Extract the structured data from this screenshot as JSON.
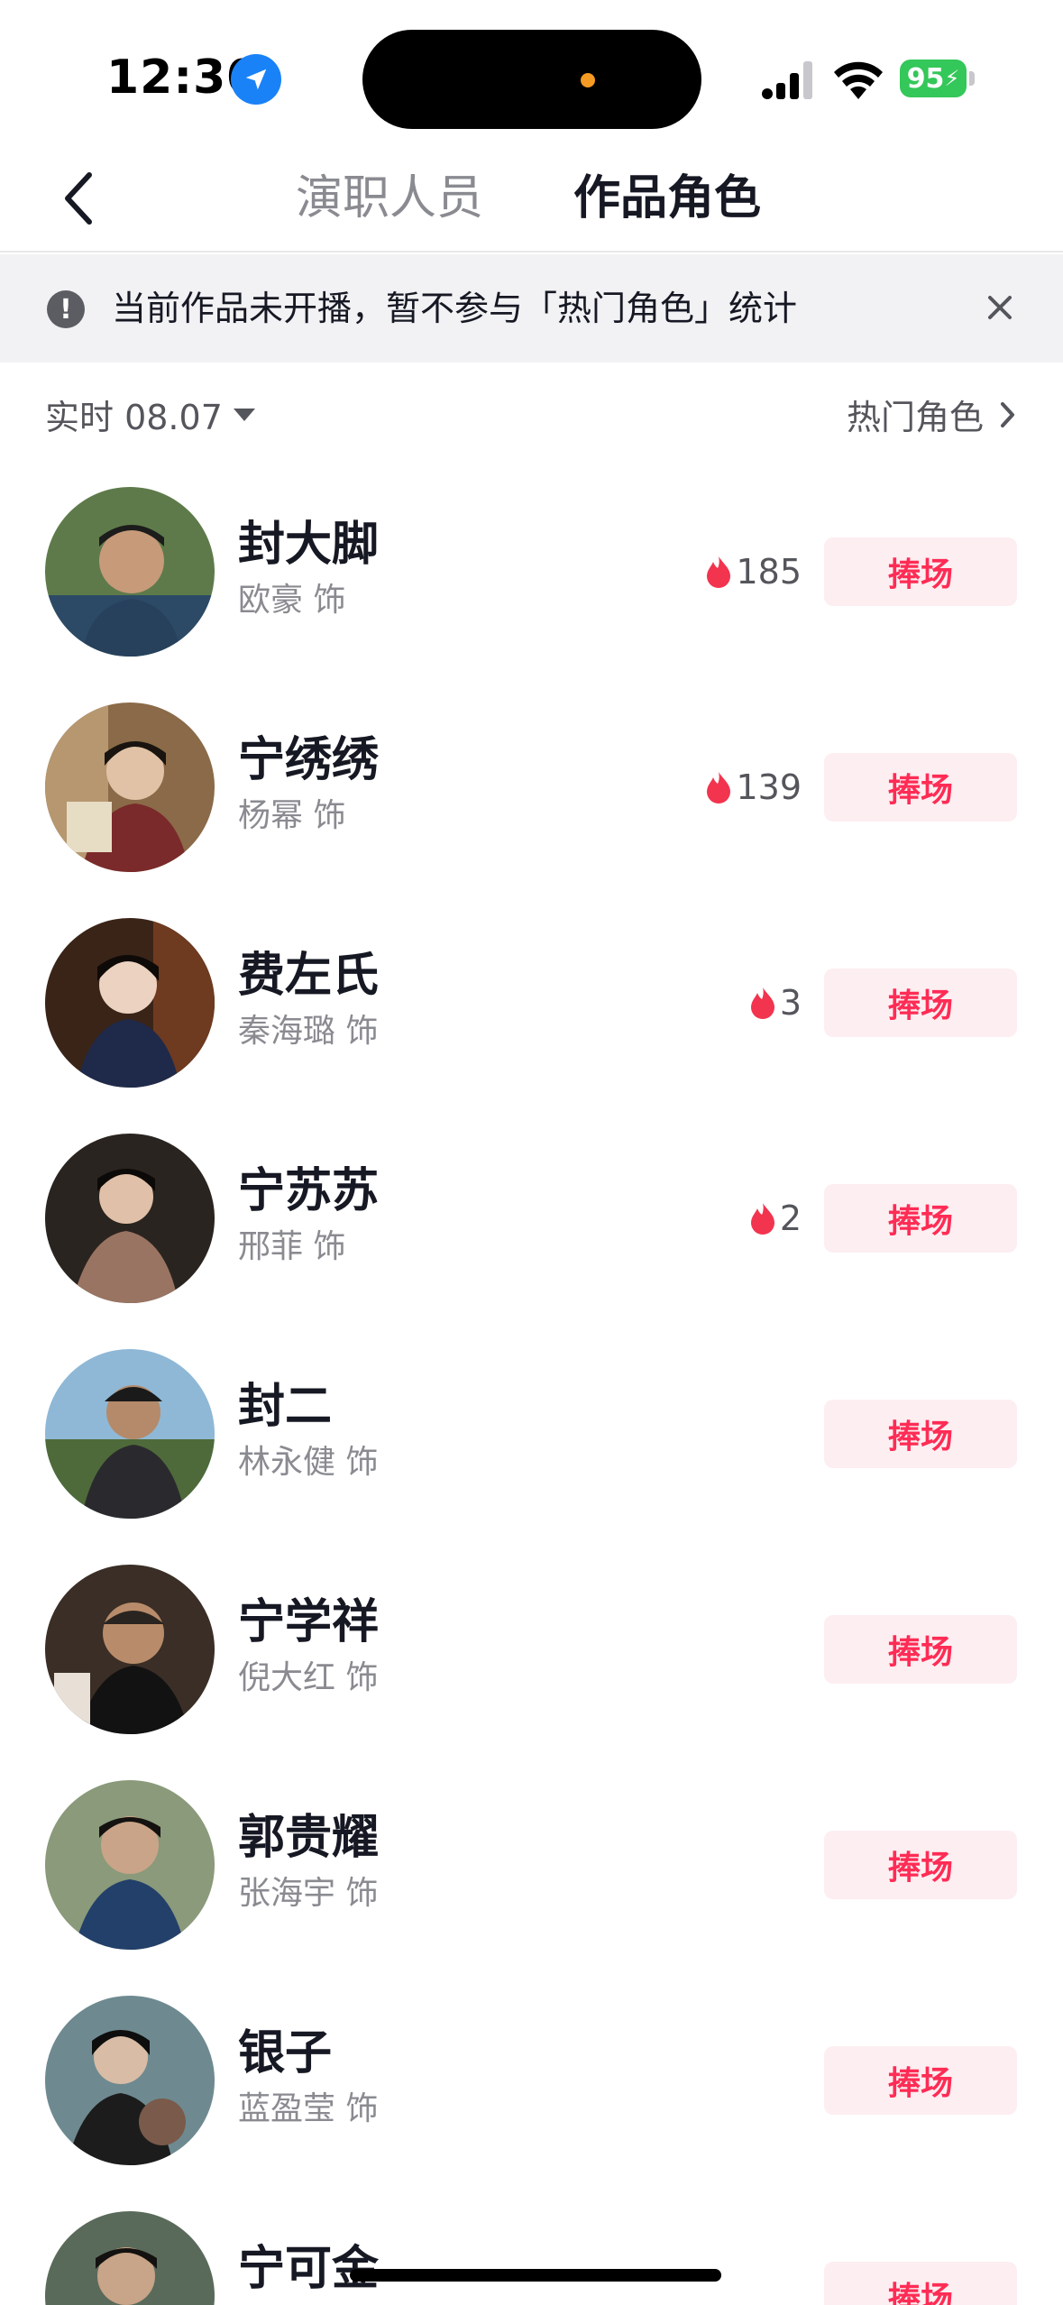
{
  "status_bar": {
    "time": "12:30",
    "battery": "95",
    "icons": [
      "location-arrow-icon",
      "cellular-signal-icon",
      "wifi-icon",
      "battery-charging-icon"
    ]
  },
  "nav": {
    "tabs": [
      {
        "label": "演职人员",
        "active": false
      },
      {
        "label": "作品角色",
        "active": true
      }
    ]
  },
  "notice": {
    "text": "当前作品未开播，暂不参与「热门角色」统计"
  },
  "filter": {
    "date_label": "实时 08.07",
    "hot_link": "热门角色"
  },
  "colors": {
    "accent": "#fe2c55",
    "button_bg": "#fdeef1",
    "fire": "#f2344f"
  },
  "roles": [
    {
      "name": "封大脚",
      "actor": "欧豪 饰",
      "heat": "185",
      "button": "捧场"
    },
    {
      "name": "宁绣绣",
      "actor": "杨幂 饰",
      "heat": "139",
      "button": "捧场"
    },
    {
      "name": "费左氏",
      "actor": "秦海璐 饰",
      "heat": "3",
      "button": "捧场"
    },
    {
      "name": "宁苏苏",
      "actor": "邢菲 饰",
      "heat": "2",
      "button": "捧场"
    },
    {
      "name": "封二",
      "actor": "林永健 饰",
      "heat": "",
      "button": "捧场"
    },
    {
      "name": "宁学祥",
      "actor": "倪大红 饰",
      "heat": "",
      "button": "捧场"
    },
    {
      "name": "郭贵耀",
      "actor": "张海宇 饰",
      "heat": "",
      "button": "捧场"
    },
    {
      "name": "银子",
      "actor": "蓝盈莹 饰",
      "heat": "",
      "button": "捧场"
    },
    {
      "name": "宁可金",
      "actor": "",
      "heat": "",
      "button": "捧场"
    }
  ]
}
